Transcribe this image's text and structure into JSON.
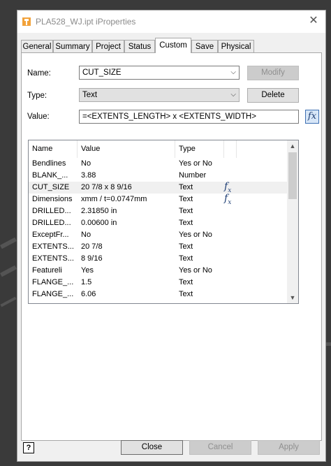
{
  "window": {
    "title": "PLA528_WJ.ipt iProperties",
    "close_glyph": "✕"
  },
  "tabs": [
    {
      "label": "General"
    },
    {
      "label": "Summary"
    },
    {
      "label": "Project"
    },
    {
      "label": "Status"
    },
    {
      "label": "Custom",
      "active": true
    },
    {
      "label": "Save"
    },
    {
      "label": "Physical"
    }
  ],
  "form": {
    "name_label": "Name:",
    "name_value": "CUT_SIZE",
    "type_label": "Type:",
    "type_value": "Text",
    "value_label": "Value:",
    "value_value": "=<EXTENTS_LENGTH> x <EXTENTS_WIDTH>",
    "modify_label": "Modify",
    "delete_label": "Delete",
    "fx_glyph": "fx"
  },
  "list": {
    "columns": [
      "Name",
      "Value",
      "Type"
    ],
    "rows": [
      {
        "name": "Bendlines",
        "value": "No",
        "type": "Yes or No",
        "fx": false
      },
      {
        "name": "BLANK_...",
        "value": "3.88",
        "type": "Number",
        "fx": false
      },
      {
        "name": "CUT_SIZE",
        "value": "20 7/8 x 8 9/16",
        "type": "Text",
        "fx": true,
        "selected": true
      },
      {
        "name": "Dimensions",
        "value": "xmm / t=0.0747mm",
        "type": "Text",
        "fx": true
      },
      {
        "name": "DRILLED...",
        "value": "2.31850 in",
        "type": "Text",
        "fx": false
      },
      {
        "name": "DRILLED...",
        "value": "0.00600 in",
        "type": "Text",
        "fx": false
      },
      {
        "name": "ExceptFr...",
        "value": "No",
        "type": "Yes or No",
        "fx": false
      },
      {
        "name": "EXTENTS...",
        "value": "20 7/8",
        "type": "Text",
        "fx": false
      },
      {
        "name": "EXTENTS...",
        "value": "8 9/16",
        "type": "Text",
        "fx": false
      },
      {
        "name": "Featureli",
        "value": "Yes",
        "type": "Yes or No",
        "fx": false
      },
      {
        "name": "FLANGE_...",
        "value": "1.5",
        "type": "Text",
        "fx": false
      },
      {
        "name": "FLANGE_...",
        "value": "6.06",
        "type": "Text",
        "fx": false
      }
    ]
  },
  "footer": {
    "help_glyph": "?",
    "close_label": "Close",
    "cancel_label": "Cancel",
    "apply_label": "Apply"
  }
}
